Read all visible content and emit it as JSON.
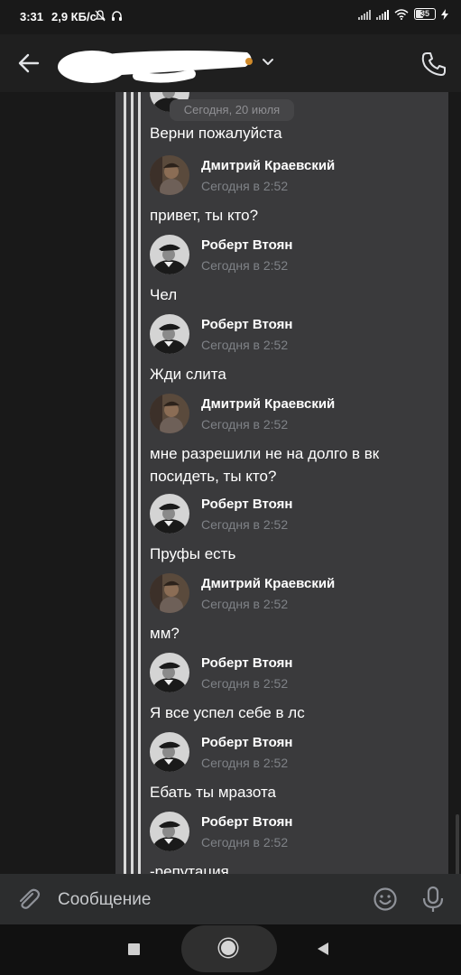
{
  "status_bar": {
    "time": "3:31",
    "network_speed": "2,9 КБ/с",
    "battery": "35"
  },
  "header": {
    "back_icon": "arrow-left-icon",
    "title_redacted": true,
    "dropdown_icon": "chevron-down-icon",
    "call_icon": "phone-icon"
  },
  "chat": {
    "date_separator": "Сегодня, 20 июля",
    "first_message": "Верни пожалуйста",
    "entries": [
      {
        "author": "Дмитрий Краевский",
        "time": "Сегодня в 2:52",
        "text": "привет, ты кто?"
      },
      {
        "author": "Роберт Втоян",
        "time": "Сегодня в 2:52",
        "text": "Чел"
      },
      {
        "author": "Роберт Втоян",
        "time": "Сегодня в 2:52",
        "text": "Жди слита"
      },
      {
        "author": "Дмитрий Краевский",
        "time": "Сегодня в 2:52",
        "text_line1": "мне разрешили не на долго в вк",
        "text_line2": "посидеть, ты кто?"
      },
      {
        "author": "Роберт Втоян",
        "time": "Сегодня в 2:52",
        "text": "Пруфы есть"
      },
      {
        "author": "Дмитрий Краевский",
        "time": "Сегодня в 2:52",
        "text": "мм?"
      },
      {
        "author": "Роберт Втоян",
        "time": "Сегодня в 2:52",
        "text": "Я все успел себе в лс"
      },
      {
        "author": "Роберт Втоян",
        "time": "Сегодня в 2:52",
        "text": "Ебать ты мразота"
      },
      {
        "author": "Роберт Втоян",
        "time": "Сегодня в 2:52",
        "text": "-репутация"
      }
    ]
  },
  "composer": {
    "placeholder": "Сообщение",
    "attach_icon": "paperclip-icon",
    "emoji_icon": "smiley-icon",
    "mic_icon": "microphone-icon"
  },
  "colors": {
    "background": "#191919",
    "card": "#3a3a3c",
    "composer": "#2c2d2e",
    "timestamp": "#7f8287"
  }
}
